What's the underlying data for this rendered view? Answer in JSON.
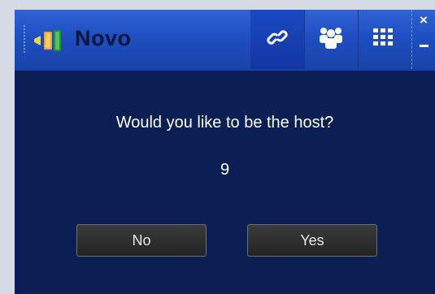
{
  "window": {
    "app_title": "Novo",
    "app_icon": "novo-app-icon",
    "toolbar": [
      {
        "name": "link",
        "icon": "link-icon"
      },
      {
        "name": "users",
        "icon": "users-icon"
      },
      {
        "name": "grid",
        "icon": "grid-icon"
      }
    ],
    "controls": {
      "close_label": "×",
      "close_icon": "close-icon",
      "minimize_icon": "minimize-icon"
    }
  },
  "dialog": {
    "question": "Would you like to be the host?",
    "countdown": "9",
    "buttons": {
      "no_label": "No",
      "yes_label": "Yes"
    }
  },
  "colors": {
    "titlebar": "#1e4ec0",
    "background": "#0c1f55",
    "button": "#2e2e2e",
    "text": "#ffffff"
  }
}
